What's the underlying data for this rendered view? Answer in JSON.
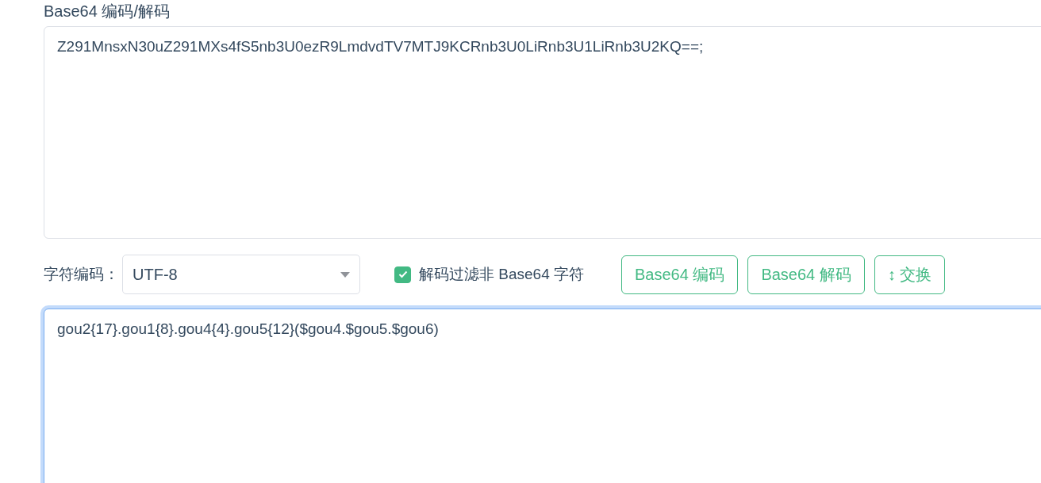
{
  "heading": "Base64 编码/解码",
  "input": {
    "value": "Z291MnsxN30uZ291MXs4fS5nb3U0ezR9LmdvdTV7MTJ9KCRnb3U0LiRnb3U1LiRnb3U2KQ==;"
  },
  "controls": {
    "encoding_label": "字符编码：",
    "encoding": {
      "value": "UTF-8"
    },
    "filter": {
      "label": "解码过滤非 Base64 字符",
      "checked": true
    },
    "buttons": [
      {
        "label": "Base64 编码"
      },
      {
        "label": "Base64 解码"
      },
      {
        "label": "↕ 交换"
      }
    ]
  },
  "output": {
    "value": "gou2{17}.gou1{8}.gou4{4}.gou5{12}($gou4.$gou5.$gou6)",
    "focused": true
  }
}
